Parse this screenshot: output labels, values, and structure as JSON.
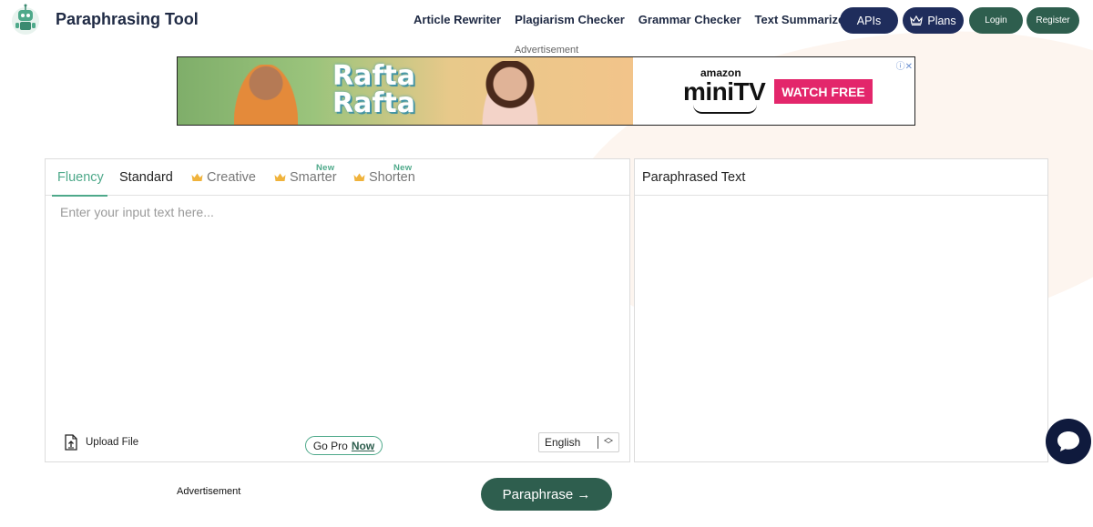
{
  "header": {
    "brand": "Paraphrasing Tool",
    "nav": [
      "Article Rewriter",
      "Plagiarism Checker",
      "Grammar Checker",
      "Text Summarizer"
    ],
    "apis_label": "APIs",
    "plans_label": "Plans",
    "login_label": "Login",
    "register_label": "Register"
  },
  "ads": {
    "top_label": "Advertisement",
    "bottom_label": "Advertisement",
    "banner": {
      "headline": "Rafta Rafta",
      "brand_small": "amazon",
      "brand_big": "miniTV",
      "cta": "WATCH FREE"
    }
  },
  "editor": {
    "tabs": [
      {
        "label": "Fluency",
        "active": true,
        "locked": false,
        "badge": ""
      },
      {
        "label": "Standard",
        "active": false,
        "locked": false,
        "badge": ""
      },
      {
        "label": "Creative",
        "active": false,
        "locked": true,
        "badge": ""
      },
      {
        "label": "Smarter",
        "active": false,
        "locked": true,
        "badge": "New"
      },
      {
        "label": "Shorten",
        "active": false,
        "locked": true,
        "badge": "New"
      }
    ],
    "input_placeholder": "Enter your input text here...",
    "input_value": "",
    "upload_label": "Upload File",
    "gopro_prefix": "Go Pro",
    "gopro_link": "Now",
    "language": "English"
  },
  "output": {
    "title": "Paraphrased Text"
  },
  "action": {
    "paraphrase_label": "Paraphrase →"
  },
  "icons": {
    "logo": "robot-logo-icon",
    "crown": "crown-icon",
    "upload": "upload-file-icon",
    "chat": "chat-icon",
    "select": "updown-arrows-icon"
  },
  "colors": {
    "navy": "#1f2d5c",
    "green": "#2e5e4e",
    "accent": "#4ea98a",
    "crown": "#f0b33c",
    "ad_cta": "#e3266b"
  }
}
